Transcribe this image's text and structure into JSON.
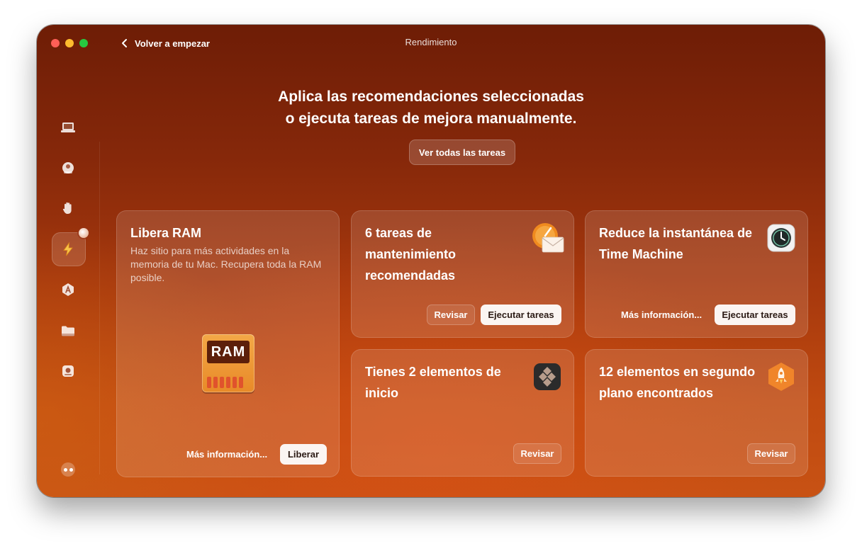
{
  "window": {
    "title": "Rendimiento",
    "back_label": "Volver a empezar"
  },
  "sidebar": {
    "items": [
      {
        "name": "sidebar-item-cleanup",
        "icon": "laptop-icon"
      },
      {
        "name": "sidebar-item-protection",
        "icon": "orb-icon"
      },
      {
        "name": "sidebar-item-privacy",
        "icon": "hand-icon"
      },
      {
        "name": "sidebar-item-performance",
        "icon": "lightning-icon",
        "active": true
      },
      {
        "name": "sidebar-item-applications",
        "icon": "app-a-icon"
      },
      {
        "name": "sidebar-item-files",
        "icon": "folder-icon"
      },
      {
        "name": "sidebar-item-assistant",
        "icon": "disk-icon"
      }
    ]
  },
  "header": {
    "line1": "Aplica las recomendaciones seleccionadas",
    "line2": "o ejecuta tareas de mejora manualmente.",
    "all_tasks_label": "Ver todas las tareas"
  },
  "cards": {
    "ram": {
      "title": "Libera RAM",
      "description": "Haz sitio para más actividades en la memoria de tu Mac. Recupera toda la RAM posible.",
      "chip_text": "RAM",
      "more_info": "Más información...",
      "action": "Liberar"
    },
    "maintenance": {
      "title_line1": "6 tareas de",
      "title_line2": "mantenimiento",
      "title_line3": "recomendadas",
      "review": "Revisar",
      "action": "Ejecutar tareas"
    },
    "timemachine": {
      "title_line1": "Reduce la instantánea de",
      "title_line2": "Time Machine",
      "more_info": "Más información...",
      "action": "Ejecutar tareas"
    },
    "startup": {
      "title_line1": "Tienes 2 elementos de",
      "title_line2": "inicio",
      "review": "Revisar"
    },
    "background": {
      "title_line1": "12 elementos en segundo",
      "title_line2": "plano encontrados",
      "review": "Revisar"
    }
  },
  "colors": {
    "accent_light_button": "#fbf5f2",
    "window_top": "#6e1d06",
    "window_bottom": "#c85214"
  }
}
